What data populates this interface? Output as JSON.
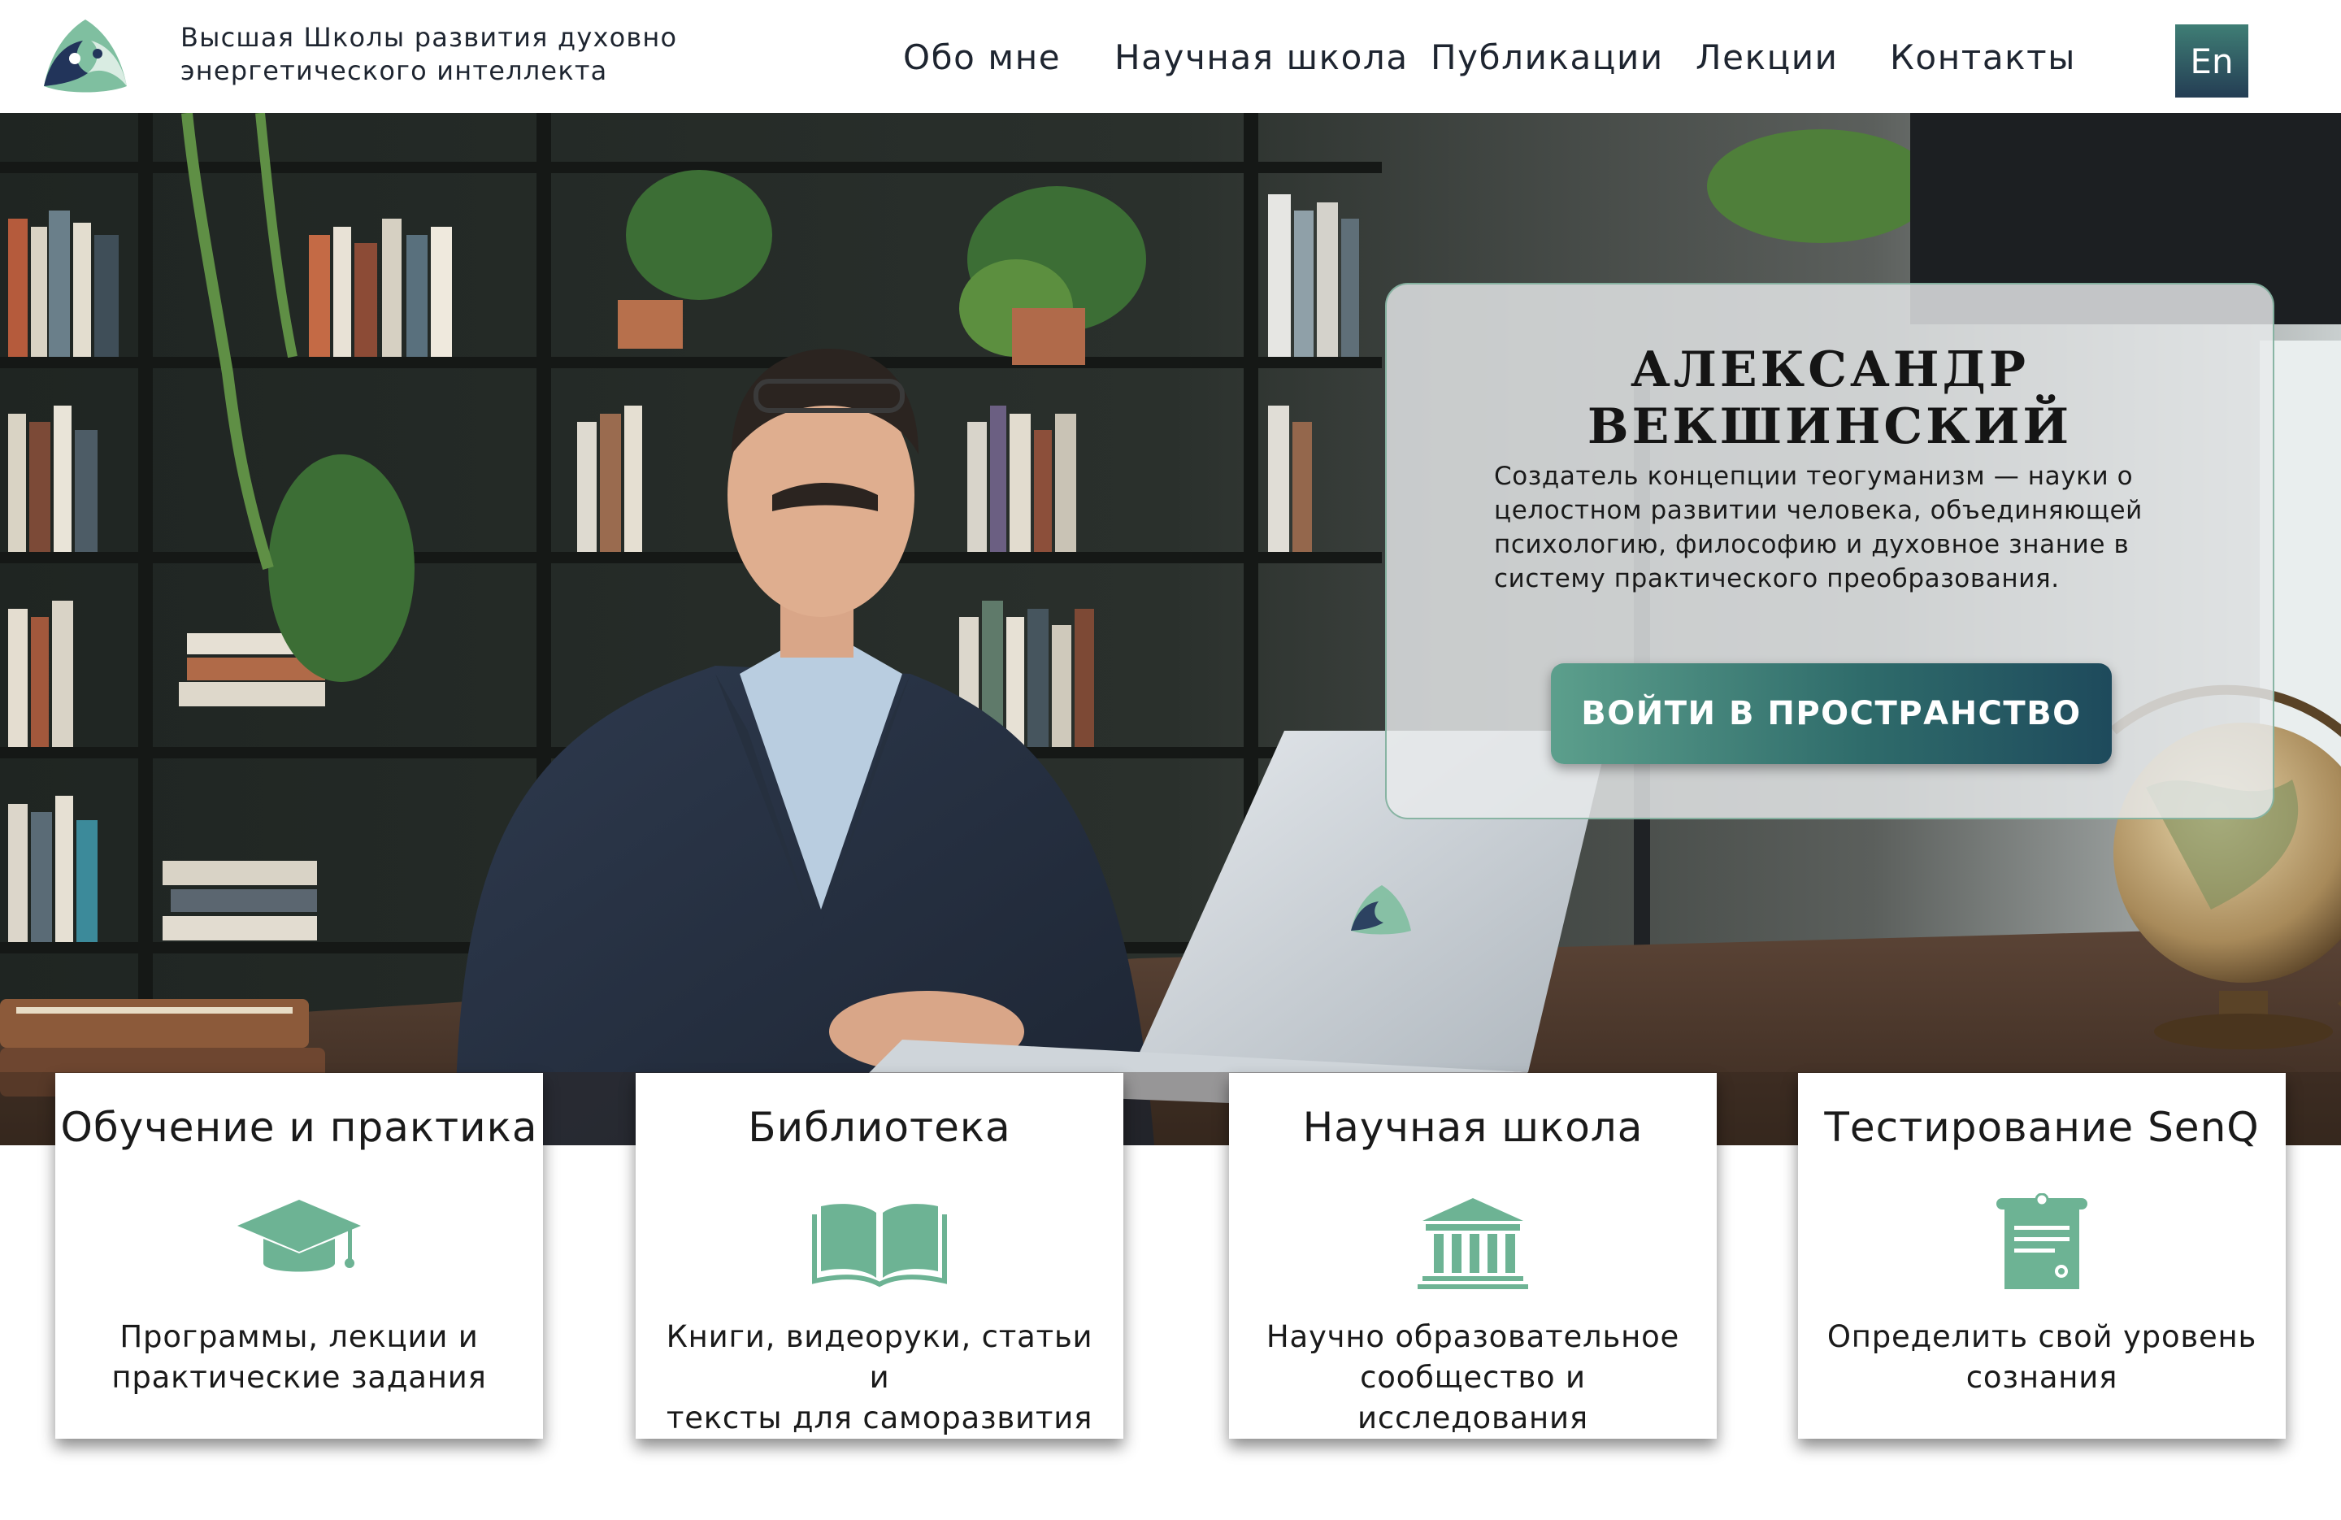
{
  "header": {
    "brand_line1": "Высшая Школы развития духовно",
    "brand_line2": "энергетического интеллекта",
    "nav": [
      "Обо мне",
      "Научная школа",
      "Публикации",
      "Лекции",
      "Контакты"
    ],
    "language": "En"
  },
  "hero": {
    "name": "АЛЕКСАНДР ВЕКШИНСКИЙ",
    "description": "Создатель концепции теогуманизм — науки о целостном развитии человека, объединяющей психологию, философию и духовное знание в систему практического преобразования.",
    "cta": "ВОЙТИ В ПРОСТРАНСТВО"
  },
  "cards": [
    {
      "title": "Обучение и практика",
      "icon": "graduation-cap-icon",
      "desc_line1": "Программы, лекции и",
      "desc_line2": "практические задания"
    },
    {
      "title": "Библиотека",
      "icon": "open-book-icon",
      "desc_line1": "Книги, видеоруки, статьи и",
      "desc_line2": "тексты для саморазвития"
    },
    {
      "title": "Научная школа",
      "icon": "university-building-icon",
      "desc_line1": "Научно образовательное",
      "desc_line2": "сообщество и исследования"
    },
    {
      "title": "Тестирование SenQ",
      "icon": "diploma-scroll-icon",
      "desc_line1": "Определить свой уровень",
      "desc_line2": "сознания"
    }
  ],
  "colors": {
    "accent": "#6db394",
    "button_dark": "#1e4a5c",
    "lang_button": "#243d54"
  }
}
